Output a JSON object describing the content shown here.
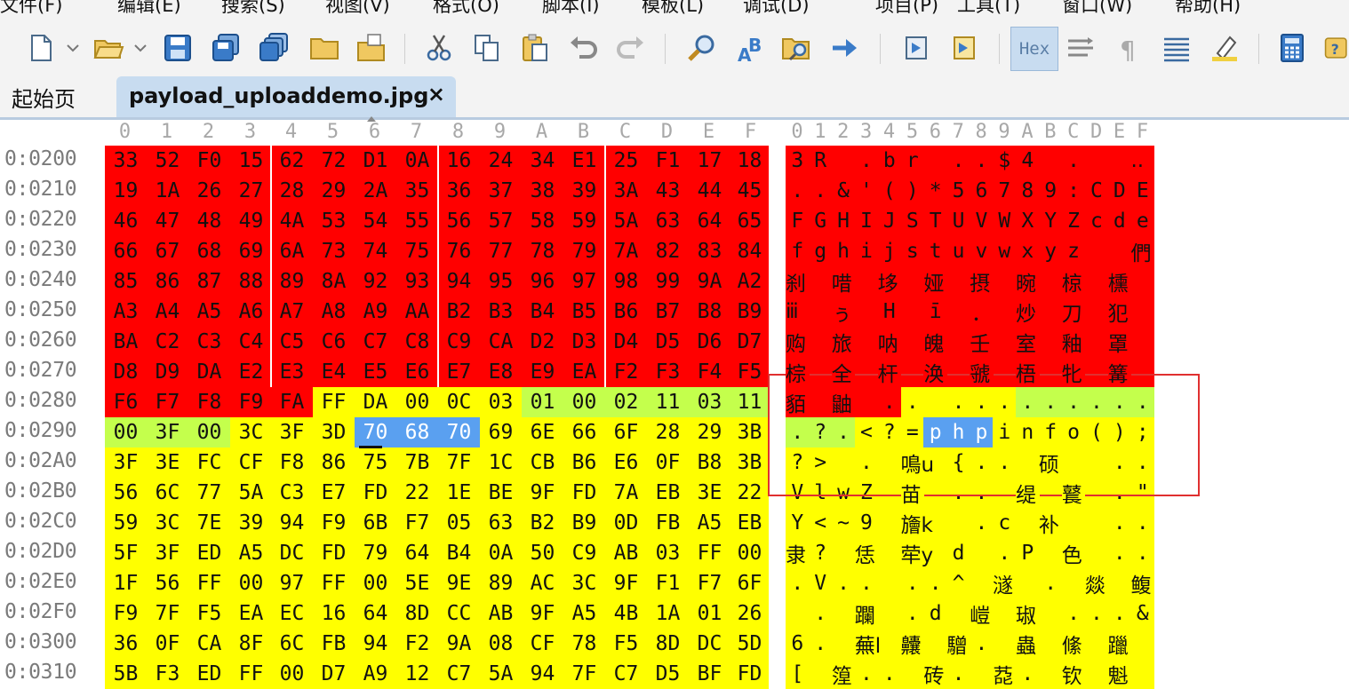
{
  "menu": [
    "文件(F)",
    "编辑(E)",
    "搜索(S)",
    "视图(V)",
    "格式(O)",
    "脚本(I)",
    "模板(L)",
    "调试(D)",
    "项目(P)",
    "工具(T)",
    "窗口(W)",
    "帮助(H)"
  ],
  "toolbar": {
    "hex_label": "Hex"
  },
  "tabs": {
    "home": "起始页",
    "active": "payload_uploaddemo.jpg",
    "close": "×"
  },
  "hex_columns": [
    "0",
    "1",
    "2",
    "3",
    "4",
    "5",
    "6",
    "7",
    "8",
    "9",
    "A",
    "B",
    "C",
    "D",
    "E",
    "F"
  ],
  "rows": [
    {
      "addr": "0:0200",
      "bytes": [
        "33",
        "52",
        "F0",
        "15",
        "62",
        "72",
        "D1",
        "0A",
        "16",
        "24",
        "34",
        "E1",
        "25",
        "F1",
        "17",
        "18"
      ],
      "ascii": [
        "3",
        "R",
        "",
        ".",
        "b",
        "r",
        "",
        ".",
        ".",
        "$",
        "4",
        "",
        ".",
        "",
        "",
        ".."
      ]
    },
    {
      "addr": "0:0210",
      "bytes": [
        "19",
        "1A",
        "26",
        "27",
        "28",
        "29",
        "2A",
        "35",
        "36",
        "37",
        "38",
        "39",
        "3A",
        "43",
        "44",
        "45"
      ],
      "ascii": [
        ".",
        ".",
        "&",
        "'",
        "(",
        ")",
        "*",
        "5",
        "6",
        "7",
        "8",
        "9",
        ":",
        "C",
        "D",
        "E"
      ]
    },
    {
      "addr": "0:0220",
      "bytes": [
        "46",
        "47",
        "48",
        "49",
        "4A",
        "53",
        "54",
        "55",
        "56",
        "57",
        "58",
        "59",
        "5A",
        "63",
        "64",
        "65"
      ],
      "ascii": [
        "F",
        "G",
        "H",
        "I",
        "J",
        "S",
        "T",
        "U",
        "V",
        "W",
        "X",
        "Y",
        "Z",
        "c",
        "d",
        "e"
      ]
    },
    {
      "addr": "0:0230",
      "bytes": [
        "66",
        "67",
        "68",
        "69",
        "6A",
        "73",
        "74",
        "75",
        "76",
        "77",
        "78",
        "79",
        "7A",
        "82",
        "83",
        "84"
      ],
      "ascii": [
        "f",
        "g",
        "h",
        "i",
        "j",
        "s",
        "t",
        "u",
        "v",
        "w",
        "x",
        "y",
        "z",
        "",
        "",
        "們"
      ]
    },
    {
      "addr": "0:0240",
      "bytes": [
        "85",
        "86",
        "87",
        "88",
        "89",
        "8A",
        "92",
        "93",
        "94",
        "95",
        "96",
        "97",
        "98",
        "99",
        "9A",
        "A2"
      ],
      "ascii": [
        "刹",
        "",
        "唶",
        "",
        "垑",
        "",
        "娅",
        "",
        "摂",
        "",
        "晼",
        "",
        "椋",
        "",
        "櫄",
        ""
      ]
    },
    {
      "addr": "0:0250",
      "bytes": [
        "A3",
        "A4",
        "A5",
        "A6",
        "A7",
        "A8",
        "A9",
        "AA",
        "B2",
        "B3",
        "B4",
        "B5",
        "B6",
        "B7",
        "B8",
        "B9"
      ],
      "ascii": [
        "ⅲ",
        "",
        "ぅ",
        "",
        "Η",
        "",
        "ī",
        "",
        "．",
        "",
        "炒",
        "",
        "刀",
        "",
        "犯",
        ""
      ]
    },
    {
      "addr": "0:0260",
      "bytes": [
        "BA",
        "C2",
        "C3",
        "C4",
        "C5",
        "C6",
        "C7",
        "C8",
        "C9",
        "CA",
        "D2",
        "D3",
        "D4",
        "D5",
        "D6",
        "D7"
      ],
      "ascii": [
        "购",
        "",
        "旅",
        "",
        "呐",
        "",
        "魄",
        "",
        "壬",
        "",
        "室",
        "",
        "釉",
        "",
        "罩",
        ""
      ]
    },
    {
      "addr": "0:0270",
      "bytes": [
        "D8",
        "D9",
        "DA",
        "E2",
        "E3",
        "E4",
        "E5",
        "E6",
        "E7",
        "E8",
        "E9",
        "EA",
        "F2",
        "F3",
        "F4",
        "F5"
      ],
      "ascii": [
        "棕",
        "",
        "全",
        "",
        "杆",
        "",
        "涣",
        "",
        "虢",
        "",
        "梧",
        "",
        "牝",
        "",
        "篝",
        ""
      ]
    },
    {
      "addr": "0:0280",
      "bytes": [
        "F6",
        "F7",
        "F8",
        "F9",
        "FA",
        "FF",
        "DA",
        "00",
        "0C",
        "03",
        "01",
        "00",
        "02",
        "11",
        "03",
        "11"
      ],
      "ascii": [
        "貊",
        "",
        "鼬",
        "",
        ".",
        ".",
        "",
        ".",
        ".",
        ".",
        ".",
        ".",
        ".",
        ".",
        ".",
        "."
      ]
    },
    {
      "addr": "0:0290",
      "bytes": [
        "00",
        "3F",
        "00",
        "3C",
        "3F",
        "3D",
        "70",
        "68",
        "70",
        "69",
        "6E",
        "66",
        "6F",
        "28",
        "29",
        "3B"
      ],
      "ascii": [
        ".",
        "?",
        ".",
        "<",
        "?",
        "=",
        "p",
        "h",
        "p",
        "i",
        "n",
        "f",
        "o",
        "(",
        ")",
        ";"
      ]
    },
    {
      "addr": "0:02A0",
      "bytes": [
        "3F",
        "3E",
        "FC",
        "CF",
        "F8",
        "86",
        "75",
        "7B",
        "7F",
        "1C",
        "CB",
        "B6",
        "E6",
        "0F",
        "B8",
        "3B"
      ],
      "ascii": [
        "?",
        ">",
        "",
        ".",
        "",
        "鳴u",
        "",
        "{",
        ".",
        ".",
        "",
        "硕",
        "",
        "",
        ".",
        "."
      ]
    },
    {
      "addr": "0:02B0",
      "bytes": [
        "56",
        "6C",
        "77",
        "5A",
        "C3",
        "E7",
        "FD",
        "22",
        "1E",
        "BE",
        "9F",
        "FD",
        "7A",
        "EB",
        "3E",
        "22"
      ],
      "ascii": [
        "V",
        "l",
        "w",
        "Z",
        "",
        "苗",
        "",
        ".",
        ".",
        "",
        "缇",
        "",
        "鼚",
        "",
        ".",
        "\""
      ]
    },
    {
      "addr": "0:02C0",
      "bytes": [
        "59",
        "3C",
        "7E",
        "39",
        "94",
        "F9",
        "6B",
        "F7",
        "05",
        "63",
        "B2",
        "B9",
        "0D",
        "FB",
        "A5",
        "EB"
      ],
      "ascii": [
        "Y",
        "<",
        "~",
        "9",
        "",
        "旝k",
        "",
        "",
        ".",
        "c",
        "",
        "补",
        "",
        "",
        ".",
        "."
      ]
    },
    {
      "addr": "0:02D0",
      "bytes": [
        "5F",
        "3F",
        "ED",
        "A5",
        "DC",
        "FD",
        "79",
        "64",
        "B4",
        "0A",
        "50",
        "C9",
        "AB",
        "03",
        "FF",
        "00"
      ],
      "ascii": [
        "隶",
        "?",
        "",
        "恁",
        "",
        "荦y",
        "",
        "d",
        "",
        ".",
        "P",
        "",
        "色",
        "",
        ".",
        "."
      ]
    },
    {
      "addr": "0:02E0",
      "bytes": [
        "1F",
        "56",
        "FF",
        "00",
        "97",
        "FF",
        "00",
        "5E",
        "9E",
        "89",
        "AC",
        "3C",
        "9F",
        "F1",
        "F7",
        "6F"
      ],
      "ascii": [
        ".",
        "V",
        ".",
        ".",
        "",
        ".",
        ".",
        "^",
        "",
        "澻",
        "",
        ".",
        "",
        "燚",
        "",
        "鳆"
      ]
    },
    {
      "addr": "0:02F0",
      "bytes": [
        "F9",
        "7F",
        "F5",
        "EA",
        "EC",
        "16",
        "64",
        "8D",
        "CC",
        "AB",
        "9F",
        "A5",
        "4B",
        "1A",
        "01",
        "26"
      ],
      "ascii": [
        "",
        ".",
        "",
        "躝",
        "",
        ".",
        "d",
        "",
        "嵦",
        "",
        "琡",
        "",
        ".",
        ".",
        ".",
        "&"
      ]
    },
    {
      "addr": "0:0300",
      "bytes": [
        "36",
        "0F",
        "CA",
        "8F",
        "6C",
        "FB",
        "94",
        "F2",
        "9A",
        "08",
        "CF",
        "78",
        "F5",
        "8D",
        "DC",
        "5D"
      ],
      "ascii": [
        "6",
        ".",
        "",
        "蕪l",
        "",
        "齉",
        "",
        "驓",
        ".",
        "",
        "蟲",
        "",
        "絛",
        "",
        "躐",
        ""
      ]
    },
    {
      "addr": "0:0310",
      "bytes": [
        "5B",
        "F3",
        "ED",
        "FF",
        "00",
        "D7",
        "A9",
        "12",
        "C7",
        "5A",
        "94",
        "7F",
        "C7",
        "D5",
        "BF",
        "FD"
      ],
      "ascii": [
        "[",
        "",
        "篞",
        ".",
        ".",
        "",
        "砖",
        ".",
        "",
        "莻",
        ".",
        "",
        "钦",
        "",
        "魁",
        ""
      ]
    }
  ],
  "colors": {
    "red": "#ff0000",
    "yellow": "#ffff00",
    "green": "#c4ff4c",
    "blue": "#5aa0f0",
    "box": "#e03030"
  }
}
